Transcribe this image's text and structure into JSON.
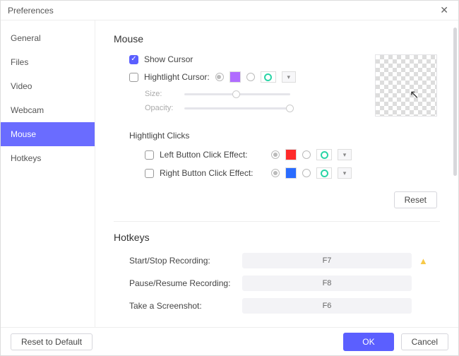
{
  "window": {
    "title": "Preferences"
  },
  "sidebar": {
    "items": [
      {
        "label": "General"
      },
      {
        "label": "Files"
      },
      {
        "label": "Video"
      },
      {
        "label": "Webcam"
      },
      {
        "label": "Mouse",
        "active": true
      },
      {
        "label": "Hotkeys"
      }
    ]
  },
  "mouse": {
    "section_title": "Mouse",
    "show_cursor": {
      "label": "Show Cursor",
      "checked": true
    },
    "highlight_cursor": {
      "label": "Hightlight Cursor:",
      "checked": false,
      "solid_color": "#b06cff",
      "solid_selected": true,
      "ring_color": "#2ad4a6",
      "ring_selected": false
    },
    "size_label": "Size:",
    "size_value": 45,
    "opacity_label": "Opacity:",
    "opacity_value": 100,
    "clicks_title": "Hightlight Clicks",
    "left_click": {
      "label": "Left Button Click Effect:",
      "checked": false,
      "solid_color": "#ff2a2a",
      "solid_selected": true,
      "ring_color": "#2ad4a6",
      "ring_selected": false
    },
    "right_click": {
      "label": "Right Button Click Effect:",
      "checked": false,
      "solid_color": "#2a6cff",
      "solid_selected": true,
      "ring_color": "#2ad4a6",
      "ring_selected": false
    },
    "reset_label": "Reset"
  },
  "hotkeys": {
    "section_title": "Hotkeys",
    "rows": [
      {
        "label": "Start/Stop Recording:",
        "key": "F7",
        "warn": true
      },
      {
        "label": "Pause/Resume Recording:",
        "key": "F8",
        "warn": false
      },
      {
        "label": "Take a Screenshot:",
        "key": "F6",
        "warn": false
      }
    ]
  },
  "footer": {
    "reset_default": "Reset to Default",
    "ok": "OK",
    "cancel": "Cancel"
  }
}
